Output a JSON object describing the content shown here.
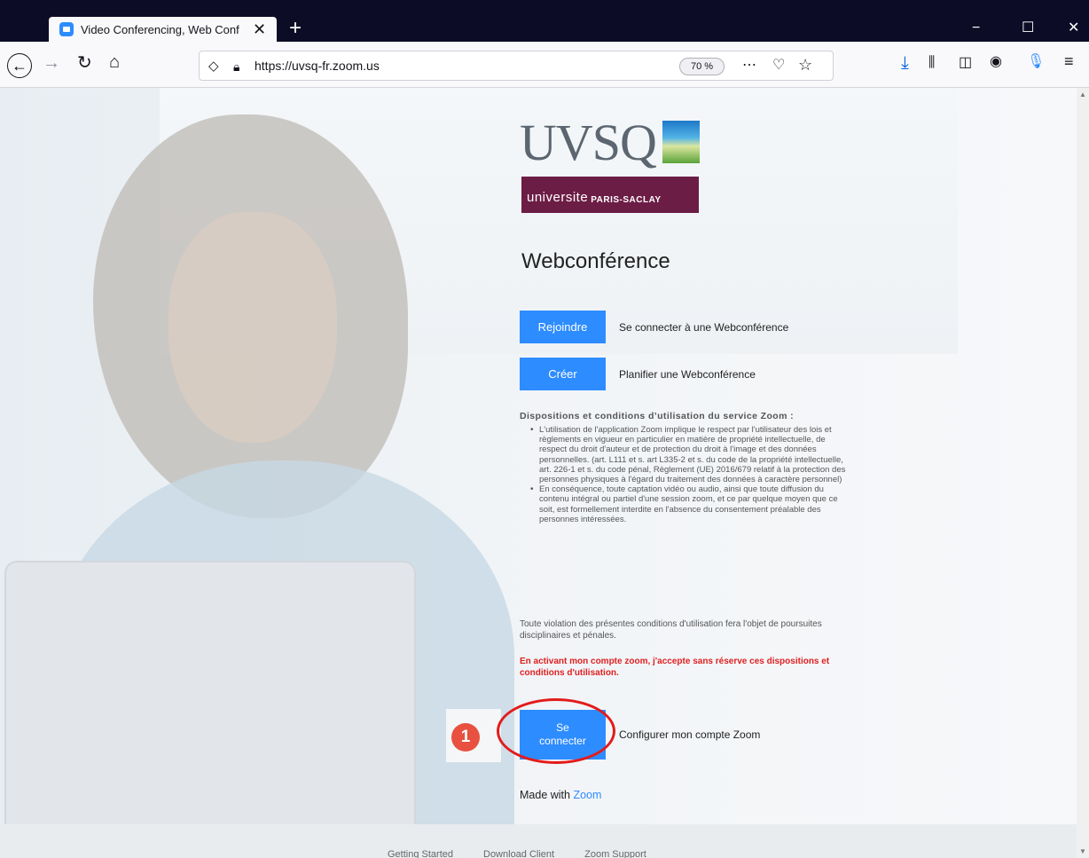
{
  "browser": {
    "tab_title": "Video Conferencing, Web Conf",
    "url": "https://uvsq-fr.zoom.us",
    "zoom": "70 %",
    "page_actions_icon": "ellipsis-icon",
    "window_controls": {
      "minimize": "−",
      "maximize": "☐",
      "close": "✕"
    }
  },
  "logos": {
    "uvsq": "UVSQ",
    "ups_main": "universite",
    "ups_sub": "PARIS-SACLAY"
  },
  "main": {
    "title": "Webconférence",
    "join_button": "Rejoindre",
    "join_desc": "Se connecter à une Webconférence",
    "create_button": "Créer",
    "create_desc": "Planifier une Webconférence",
    "terms_title": "Dispositions et conditions d’utilisation du service Zoom :",
    "terms_items": [
      "L'utilisation de l'application Zoom implique le respect par l'utilisateur des lois et règlements en vigueur en particulier en matière de propriété intellectuelle, de respect du droit d'auteur et de protection du droit à l'image et des données personnelles. (art. L111 et s. art L335-2 et s. du code de la propriété intellectuelle, art. 226-1 et s. du code pénal, Règlement (UE) 2016/679 relatif à la protection des personnes physiques à l'égard du traitement des données à caractère personnel)",
      "En conséquence, toute captation vidéo ou audio, ainsi que toute diffusion du contenu intégral ou partiel d'une session zoom, et ce par quelque moyen que ce soit, est formellement interdite en l'absence du consentement préalable des personnes intéressées."
    ],
    "terms_note": "Toute violation des présentes conditions d'utilisation fera l'objet de poursuites disciplinaires et pénales.",
    "terms_warning": "En activant mon compte zoom, j'accepte sans réserve ces dispositions et conditions d'utilisation.",
    "connect_button_line1": "Se",
    "connect_button_line2": "connecter",
    "connect_desc": "Configurer mon compte Zoom",
    "step_number": "1",
    "made_with_prefix": "Made with",
    "made_with_link": "Zoom"
  },
  "footer": {
    "links": [
      "Getting Started",
      "Download Client",
      "Zoom Support"
    ]
  },
  "colors": {
    "zoom_blue": "#2d8cff",
    "warning_red": "#e02020",
    "ups_purple": "#6c1d45",
    "highlight_red": "#e31b1b"
  }
}
